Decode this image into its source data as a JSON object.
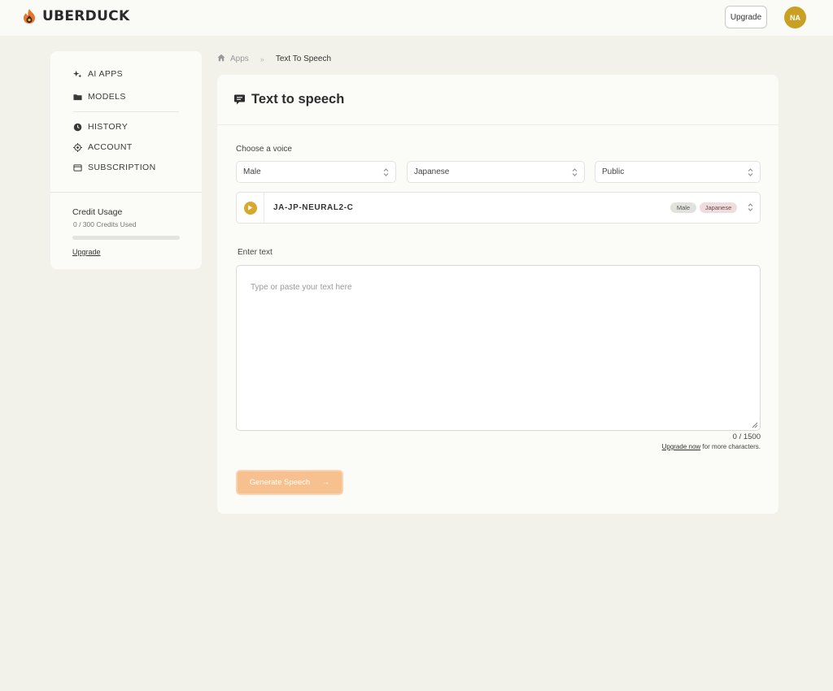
{
  "header": {
    "brand": "UBERDUCK",
    "upgrade_label": "Upgrade",
    "avatar_initials": "NA"
  },
  "sidebar": {
    "items": [
      {
        "label": "AI APPS",
        "icon": "sparkles-icon"
      },
      {
        "label": "MODELS",
        "icon": "folder-icon"
      },
      {
        "label": "HISTORY",
        "icon": "clock-icon"
      },
      {
        "label": "ACCOUNT",
        "icon": "target-icon"
      },
      {
        "label": "SUBSCRIPTION",
        "icon": "card-icon"
      }
    ],
    "credit": {
      "title": "Credit Usage",
      "used_text": "0 / 300 Credits Used",
      "used_fraction": 0,
      "link": "Upgrade"
    }
  },
  "breadcrumb": {
    "home_icon": "home-icon",
    "apps": "Apps",
    "separator": "»",
    "current": "Text To Speech"
  },
  "main": {
    "title": "Text to speech",
    "choose_voice_label": "Choose a voice",
    "filters": {
      "gender": "Male",
      "language": "Japanese",
      "visibility": "Public"
    },
    "voice": {
      "name": "JA-JP-NEURAL2-C",
      "tags": [
        "Male",
        "Japanese"
      ]
    },
    "enter_text_label": "Enter text",
    "textarea_placeholder": "Type or paste your text here",
    "char_count": "0 / 1500",
    "upgrade_link": "Upgrade now",
    "upgrade_suffix": " for more characters.",
    "generate_label": "Generate Speech",
    "generate_arrow": "→"
  },
  "colors": {
    "accent": "#d6a830",
    "button": "#f7c08f",
    "background": "#f3f2ea"
  }
}
